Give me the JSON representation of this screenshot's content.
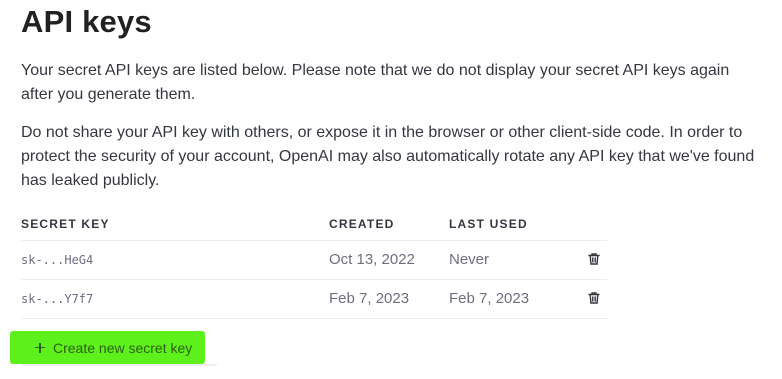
{
  "page": {
    "title": "API keys",
    "paragraph1": "Your secret API keys are listed below. Please note that we do not display your secret API keys again after you generate them.",
    "paragraph2": "Do not share your API key with others, or expose it in the browser or other client-side code. In order to protect the security of your account, OpenAI may also automatically rotate any API key that we've found has leaked publicly."
  },
  "table": {
    "headers": {
      "secret_key": "SECRET KEY",
      "created": "CREATED",
      "last_used": "LAST USED"
    },
    "rows": [
      {
        "key": "sk-...HeG4",
        "created": "Oct 13, 2022",
        "last_used": "Never",
        "action_icon": "trash-icon"
      },
      {
        "key": "sk-...Y7f7",
        "created": "Feb 7, 2023",
        "last_used": "Feb 7, 2023",
        "action_icon": "trash-icon"
      }
    ]
  },
  "actions": {
    "create_label": "Create new secret key",
    "create_icon": "plus-icon"
  },
  "colors": {
    "highlight": "#5ef01b",
    "text": "#353740",
    "muted": "#6e6e80"
  }
}
